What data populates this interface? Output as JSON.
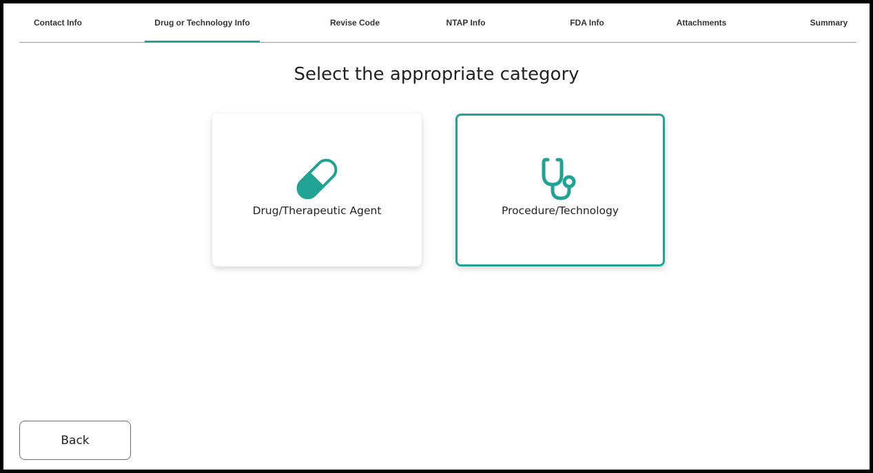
{
  "steps": [
    {
      "label": "Contact Info",
      "active": false
    },
    {
      "label": "Drug or Technology Info",
      "active": true
    },
    {
      "label": "Revise Code",
      "active": false
    },
    {
      "label": "NTAP Info",
      "active": false
    },
    {
      "label": "FDA Info",
      "active": false
    },
    {
      "label": "Attachments",
      "active": false
    },
    {
      "label": "Summary",
      "active": false
    }
  ],
  "page": {
    "title": "Select the appropriate category"
  },
  "categories": [
    {
      "label": "Drug/Therapeutic Agent",
      "icon": "pill-icon",
      "selected": false
    },
    {
      "label": "Procedure/Technology",
      "icon": "stethoscope-icon",
      "selected": true
    }
  ],
  "actions": {
    "back_label": "Back"
  },
  "colors": {
    "accent": "#1fa394",
    "text": "#222222",
    "divider": "#9a9a9a"
  }
}
